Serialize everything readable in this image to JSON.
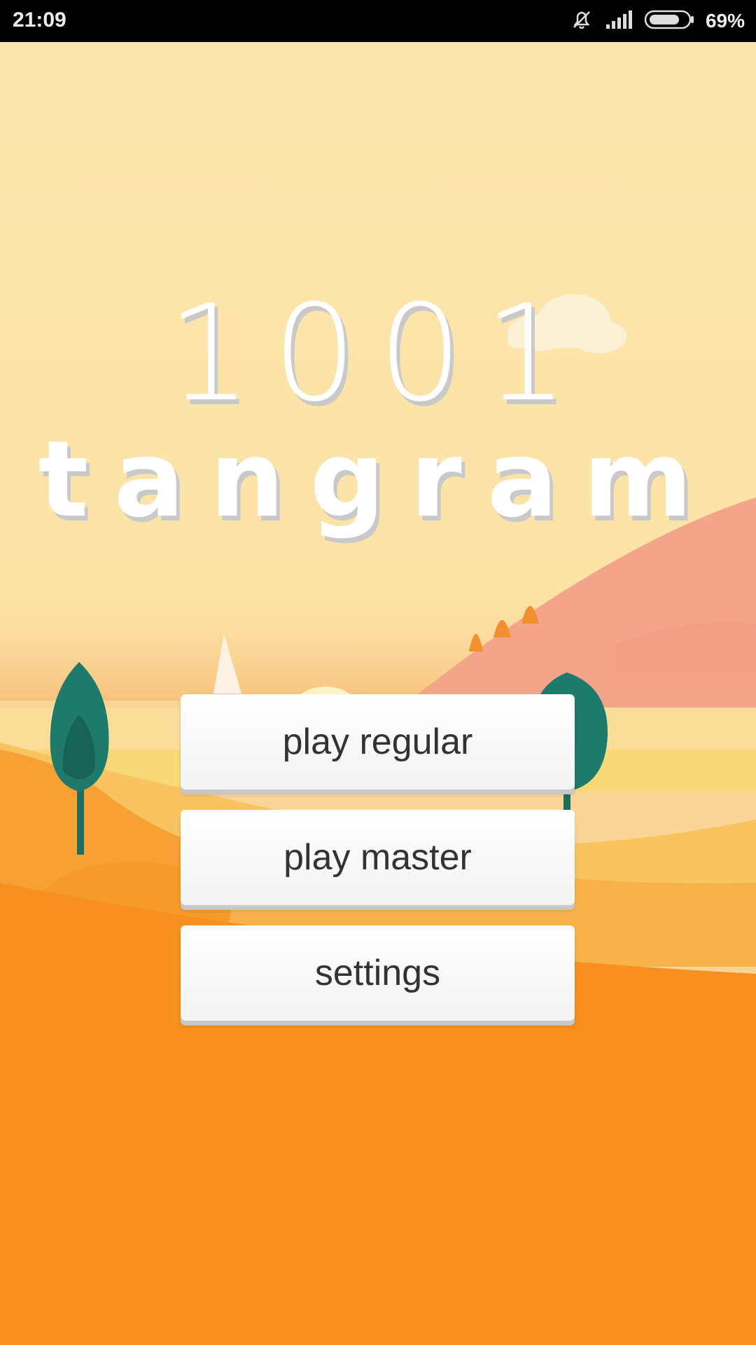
{
  "status_bar": {
    "time": "21:09",
    "battery_percent": "69%",
    "icons": [
      "alarm-off-icon",
      "signal-icon",
      "battery-icon"
    ]
  },
  "title": {
    "line1": "1001",
    "line2": "tangram"
  },
  "menu": {
    "play_regular": "play regular",
    "play_master": "play master",
    "settings": "settings"
  },
  "colors": {
    "sky": "#fde6ae",
    "hill_pink": "#f3a58a",
    "ground_orange": "#f7901e",
    "tree_green": "#1e7a6a",
    "button_text": "#333333"
  }
}
